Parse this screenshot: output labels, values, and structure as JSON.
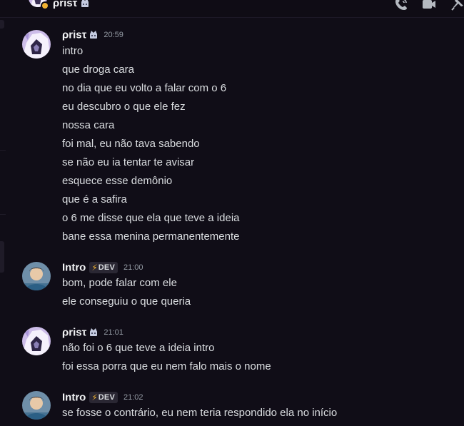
{
  "channel": {
    "title": "ρrisτ"
  },
  "colors": {
    "background": "#100d17",
    "text": "#dbdee1",
    "username": "#f2f3f5",
    "timestamp": "#949ba4",
    "bolt": "#f0b232",
    "tag_bg": "#2a2733"
  },
  "icons": {
    "call": "phone-icon",
    "video": "video-camera-icon",
    "pin": "pin-icon",
    "crown": "crown-badge-icon",
    "bolt": "lightning-bolt-icon"
  },
  "messages": [
    {
      "author": "ρrisτ",
      "time": "20:59",
      "lines": [
        "intro",
        "que droga cara",
        "no dia que eu volto a falar com o 6",
        "eu descubro o que ele fez",
        "nossa cara",
        "foi mal, eu não tava sabendo",
        "se não eu ia tentar te avisar",
        "esquece esse demônio",
        "que é a safira",
        "o 6 me disse que ela que teve a ideia",
        "bane essa menina permanentemente"
      ]
    },
    {
      "author": "Intro",
      "tag": "DEV",
      "time": "21:00",
      "lines": [
        "bom, pode falar com ele",
        "ele conseguiu o que queria"
      ]
    },
    {
      "author": "ρrisτ",
      "time": "21:01",
      "lines": [
        "não foi o 6 que teve a ideia intro",
        "foi essa porra que eu nem falo mais o nome"
      ]
    },
    {
      "author": "Intro",
      "tag": "DEV",
      "time": "21:02",
      "lines": [
        "se fosse o contrário, eu nem teria respondido ela no início"
      ]
    }
  ]
}
